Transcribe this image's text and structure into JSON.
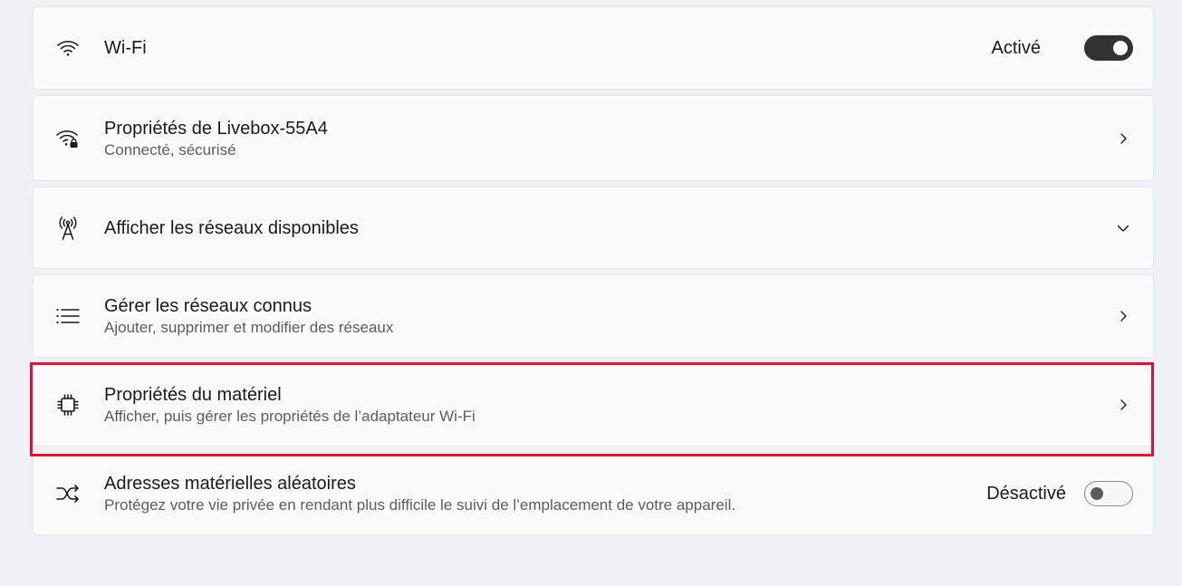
{
  "wifi": {
    "title": "Wi-Fi",
    "state_label": "Activé",
    "icon": "wifi-icon",
    "toggle_on": true
  },
  "network_properties": {
    "title": "Propriétés de Livebox-55A4",
    "subtitle": "Connecté, sécurisé",
    "icon": "wifi-lock-icon"
  },
  "available_networks": {
    "title": "Afficher les réseaux disponibles",
    "icon": "antenna-icon"
  },
  "known_networks": {
    "title": "Gérer les réseaux connus",
    "subtitle": "Ajouter, supprimer et modifier des réseaux",
    "icon": "list-icon"
  },
  "hardware_properties": {
    "title": "Propriétés du matériel",
    "subtitle": "Afficher, puis gérer les propriétés de l’adaptateur Wi-Fi",
    "icon": "chip-icon",
    "highlight_color": "#e3112f"
  },
  "random_addresses": {
    "title": "Adresses matérielles aléatoires",
    "subtitle": "Protégez votre vie privée en rendant plus difficile le suivi de l’emplacement de votre appareil.",
    "state_label": "Désactivé",
    "icon": "shuffle-icon",
    "toggle_on": false
  },
  "colors": {
    "toggle_on": "#323232",
    "card_bg": "#fbfbfc",
    "page_bg": "#eef2f6"
  }
}
